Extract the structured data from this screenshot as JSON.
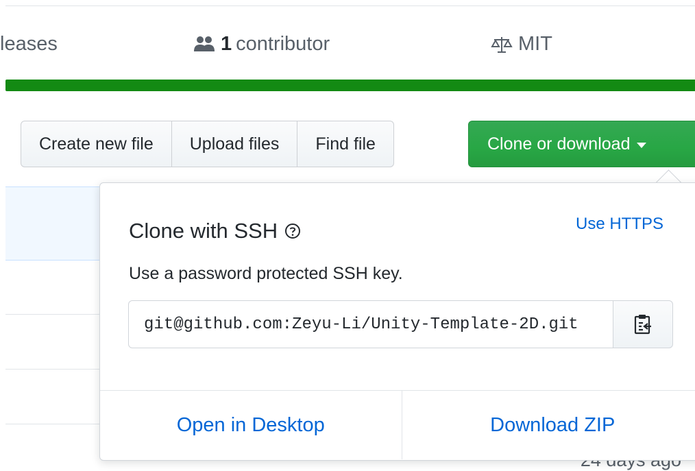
{
  "summary": {
    "releases_label": "leases",
    "contributors_count": "1",
    "contributors_label": "contributor",
    "license": "MIT"
  },
  "toolbar": {
    "create_file": "Create new file",
    "upload_files": "Upload files",
    "find_file": "Find file",
    "clone_download": "Clone or download"
  },
  "clone_popover": {
    "title": "Clone with SSH",
    "switch_link": "Use HTTPS",
    "description": "Use a password protected SSH key.",
    "url_value": "git@github.com:Zeyu-Li/Unity-Template-2D.git",
    "open_desktop": "Open in Desktop",
    "download_zip": "Download ZIP"
  },
  "file_list": {
    "age_text": "24 days ago"
  },
  "colors": {
    "language_bar": "#138a13",
    "primary_button": "#28a745",
    "link": "#0366d6"
  },
  "icons": {
    "contributors": "people-icon",
    "license": "law-icon",
    "help": "question-icon",
    "copy": "clippy-icon",
    "caret": "caret-down-icon"
  }
}
